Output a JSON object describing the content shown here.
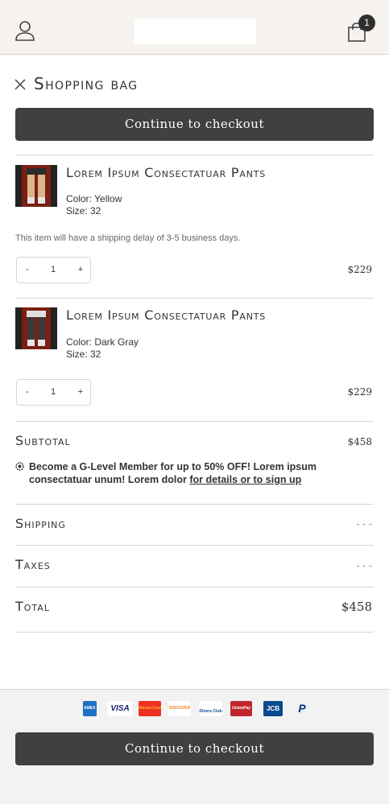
{
  "header": {
    "cart_count": "1",
    "icons": [
      "user-icon",
      "shopping-bag-icon"
    ]
  },
  "bag": {
    "title": "Shopping bag",
    "checkout_label": "Continue to checkout"
  },
  "items": [
    {
      "name": "Lorem Ipsum Consectatuar Pants",
      "color": "Color: Yellow",
      "size": "Size: 32",
      "notice": "This item will have a shipping delay of 3-5 business days.",
      "qty_minus": "-",
      "quantity": "1",
      "qty_plus": "+",
      "price": "$229"
    },
    {
      "name": "Lorem Ipsum Consectatuar Pants",
      "color": "Color: Dark Gray",
      "size": "Size: 32",
      "qty_minus": "-",
      "quantity": "1",
      "qty_plus": "+",
      "price": "$229"
    }
  ],
  "summary": {
    "subtotal_label": "Subtotal",
    "subtotal_value": "$458",
    "promo_text": "Become a G-Level Member for up to 50% OFF! Lorem ipsum consectatuar unum! Lorem dolor ",
    "promo_link": "for details or to sign up",
    "shipping_label": "Shipping",
    "shipping_value": "- - -",
    "taxes_label": "Taxes",
    "taxes_value": "- - -",
    "total_label": "Total",
    "total_value": "$458"
  },
  "footer": {
    "payment_methods": [
      {
        "icon": "amex-icon",
        "label": "AMEX"
      },
      {
        "icon": "visa-icon",
        "label": "VISA"
      },
      {
        "icon": "mastercard-icon",
        "label": "MasterCard"
      },
      {
        "icon": "discover-icon",
        "label": "DISCOVER"
      },
      {
        "icon": "diners-club-icon",
        "label": "Diners Club"
      },
      {
        "icon": "unionpay-icon",
        "label": "UnionPay"
      },
      {
        "icon": "jcb-icon",
        "label": "JCB"
      },
      {
        "icon": "paypal-icon",
        "label": "P"
      }
    ],
    "checkout_label": "Continue to checkout"
  },
  "colors": {
    "header_bg": "#f6f3ef",
    "button_bg": "#404040",
    "footer_bg": "#f2f2f2"
  }
}
